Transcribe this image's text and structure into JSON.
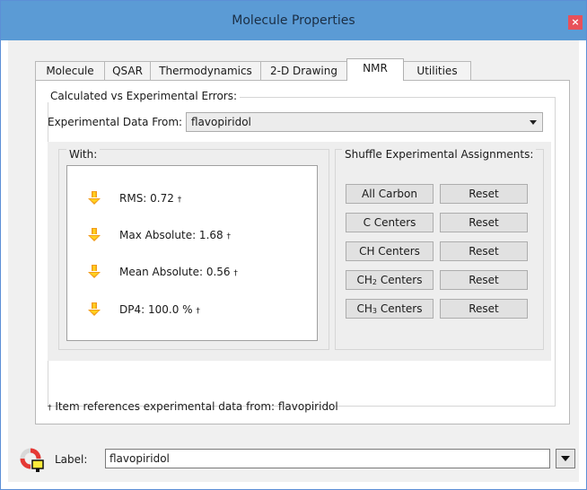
{
  "window": {
    "title": "Molecule Properties",
    "close_label": "×"
  },
  "tabs": [
    {
      "label": "Molecule"
    },
    {
      "label": "QSAR"
    },
    {
      "label": "Thermodynamics"
    },
    {
      "label": "2-D Drawing"
    },
    {
      "label": "NMR",
      "active": true
    },
    {
      "label": "Utilities"
    }
  ],
  "errors": {
    "group_title": "Calculated vs Experimental Errors:",
    "exp_label": "Experimental Data From:",
    "exp_value": "flavopiridol",
    "with_title": "With:",
    "stats": [
      {
        "label": "RMS: 0.72",
        "mark": "†",
        "icon": "flame-down-arrow-icon"
      },
      {
        "label": "Max Absolute: 1.68",
        "mark": "†",
        "icon": "flame-down-arrow-icon"
      },
      {
        "label": "Mean Absolute: 0.56",
        "mark": "†",
        "icon": "flame-down-arrow-icon"
      },
      {
        "label": "DP4: 100.0 %",
        "mark": "†",
        "icon": "flame-down-arrow-icon"
      }
    ],
    "shuffle_title": "Shuffle Experimental Assignments:",
    "shuffle_rows": [
      {
        "main": "All Carbon",
        "main_sub": "",
        "main_suffix": "",
        "reset": "Reset"
      },
      {
        "main": "C Centers",
        "main_sub": "",
        "main_suffix": "",
        "reset": "Reset"
      },
      {
        "main": "CH Centers",
        "main_sub": "",
        "main_suffix": "",
        "reset": "Reset"
      },
      {
        "main": "CH",
        "main_sub": "2",
        "main_suffix": " Centers",
        "reset": "Reset"
      },
      {
        "main": "CH",
        "main_sub": "3",
        "main_suffix": " Centers",
        "reset": "Reset"
      }
    ],
    "footnote_mark": "†",
    "footnote_text": " Item references experimental data from: flavopiridol"
  },
  "label_row": {
    "label": "Label:",
    "value": "flavopiridol",
    "icon": "lifebuoy-tag-icon"
  },
  "colors": {
    "titlebar": "#5b9bd5",
    "close": "#e8515a",
    "icon_orange": "#f29b1c",
    "icon_yellow": "#ffd21e"
  }
}
